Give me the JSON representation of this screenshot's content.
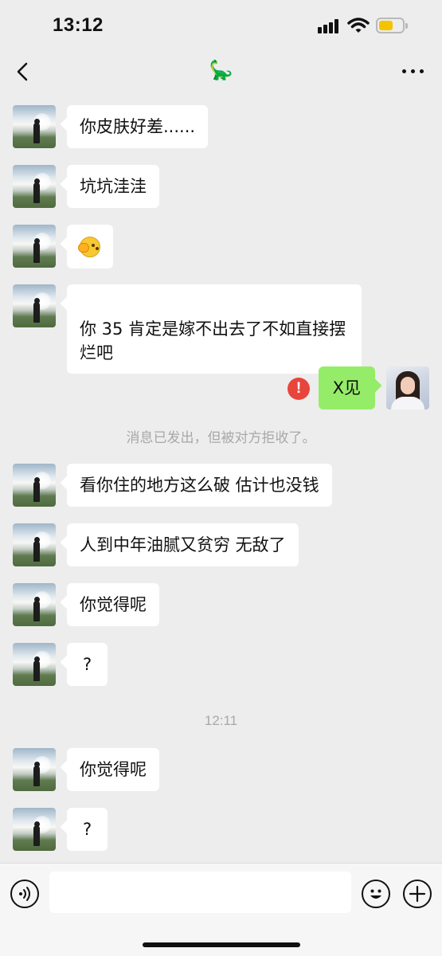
{
  "status_bar": {
    "time": "13:12"
  },
  "nav": {
    "title": "🦕"
  },
  "messages": [
    {
      "side": "left",
      "text": "你皮肤好差......"
    },
    {
      "side": "left",
      "text": "坑坑洼洼"
    },
    {
      "side": "left",
      "type": "emoji",
      "emoji_name": "face-with-hand-emoji"
    },
    {
      "side": "left",
      "text": "你 35 肯定是嫁不出去了不如直接摆\n烂吧"
    },
    {
      "side": "right",
      "text": "X见",
      "status": "error"
    },
    {
      "side": "left",
      "text": "看你住的地方这么破 估计也没钱"
    },
    {
      "side": "left",
      "text": "人到中年油腻又贫穷 无敌了"
    },
    {
      "side": "left",
      "text": "你觉得呢"
    },
    {
      "side": "left",
      "text": "?"
    },
    {
      "side": "left",
      "text": "你觉得呢"
    },
    {
      "side": "left",
      "text": "?"
    }
  ],
  "system_notice": "消息已发出，但被对方拒收了。",
  "timestamp": "12:11",
  "input": {
    "value": ""
  },
  "colors": {
    "incoming_bubble": "#ffffff",
    "outgoing_bubble": "#95ec69",
    "error": "#e8453c",
    "background": "#ededed"
  }
}
